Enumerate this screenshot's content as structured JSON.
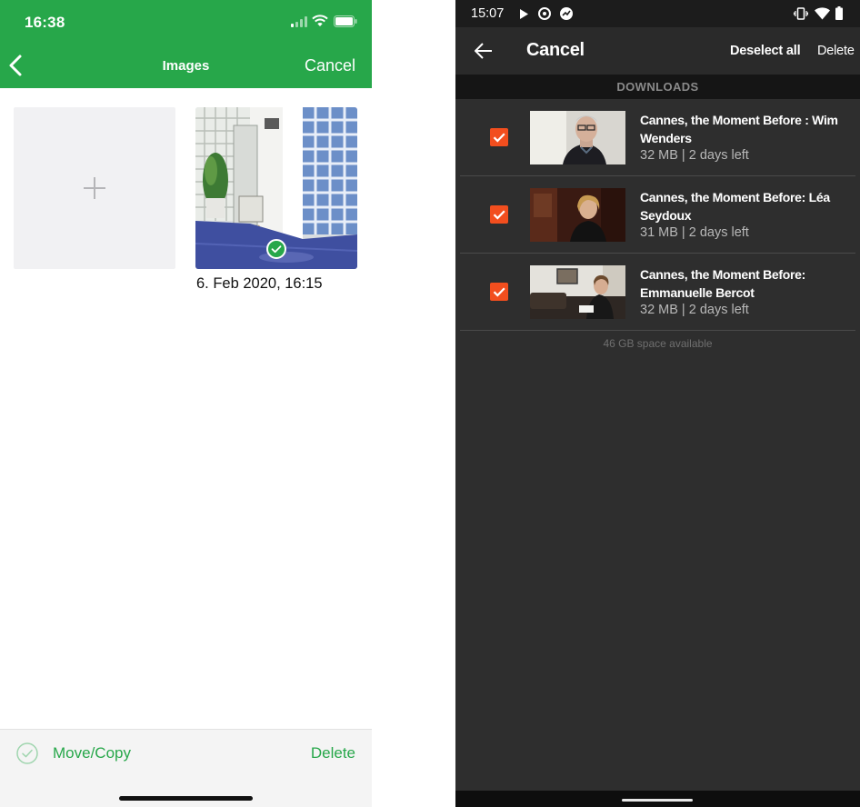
{
  "ios": {
    "status_time": "16:38",
    "title": "Images",
    "cancel_label": "Cancel",
    "image_caption": "6. Feb 2020, 16:15",
    "move_copy_label": "Move/Copy",
    "delete_label": "Delete",
    "accent_color": "#27a74a",
    "icons": [
      "back-chevron-icon",
      "signal-icon",
      "wifi-icon",
      "battery-icon",
      "plus-icon",
      "checkmark-badge-icon",
      "circle-check-icon"
    ]
  },
  "android": {
    "status_time": "15:07",
    "title": "Cancel",
    "deselect_all_label": "Deselect all",
    "delete_label": "Delete",
    "section_header": "DOWNLOADS",
    "accent_color": "#f24e1e",
    "items": [
      {
        "title": "Cannes, the Moment Before : Wim Wenders",
        "meta": "32 MB | 2 days left",
        "checked": true
      },
      {
        "title": "Cannes, the Moment Before: Léa Seydoux",
        "meta": "31 MB | 2 days left",
        "checked": true
      },
      {
        "title": "Cannes, the Moment Before: Emmanuelle Bercot",
        "meta": "32 MB | 2 days left",
        "checked": true
      }
    ],
    "space_available": "46 GB space available",
    "icons": [
      "back-arrow-icon",
      "play-icon",
      "vibrate-icon",
      "wifi-icon",
      "battery-icon",
      "checkbox-checked-icon"
    ]
  }
}
